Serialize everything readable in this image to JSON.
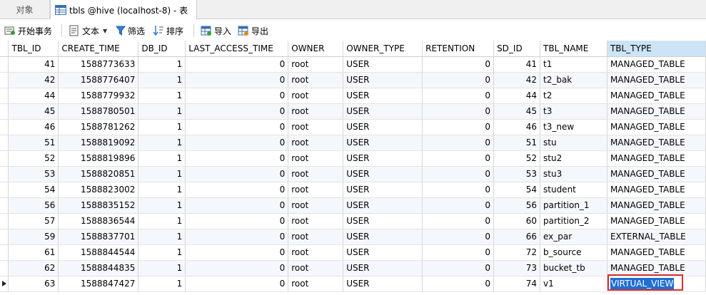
{
  "tabs": [
    {
      "label": "对象"
    },
    {
      "label": "tbls @hive (localhost-8) - 表"
    }
  ],
  "toolbar": {
    "begin_transaction": "开始事务",
    "text": "文本",
    "filter": "筛选",
    "sort": "排序",
    "import": "导入",
    "export": "导出"
  },
  "table": {
    "columns": [
      "TBL_ID",
      "CREATE_TIME",
      "DB_ID",
      "LAST_ACCESS_TIME",
      "OWNER",
      "OWNER_TYPE",
      "RETENTION",
      "SD_ID",
      "TBL_NAME",
      "TBL_TYPE"
    ],
    "selected_column": "TBL_TYPE",
    "rows": [
      [
        "41",
        "1588773633",
        "1",
        "0",
        "root",
        "USER",
        "0",
        "41",
        "t1",
        "MANAGED_TABLE"
      ],
      [
        "42",
        "1588776407",
        "1",
        "0",
        "root",
        "USER",
        "0",
        "42",
        "t2_bak",
        "MANAGED_TABLE"
      ],
      [
        "44",
        "1588779932",
        "1",
        "0",
        "root",
        "USER",
        "0",
        "44",
        "t2",
        "MANAGED_TABLE"
      ],
      [
        "45",
        "1588780501",
        "1",
        "0",
        "root",
        "USER",
        "0",
        "45",
        "t3",
        "MANAGED_TABLE"
      ],
      [
        "46",
        "1588781262",
        "1",
        "0",
        "root",
        "USER",
        "0",
        "46",
        "t3_new",
        "MANAGED_TABLE"
      ],
      [
        "51",
        "1588819092",
        "1",
        "0",
        "root",
        "USER",
        "0",
        "51",
        "stu",
        "MANAGED_TABLE"
      ],
      [
        "52",
        "1588819896",
        "1",
        "0",
        "root",
        "USER",
        "0",
        "52",
        "stu2",
        "MANAGED_TABLE"
      ],
      [
        "53",
        "1588820851",
        "1",
        "0",
        "root",
        "USER",
        "0",
        "53",
        "stu3",
        "MANAGED_TABLE"
      ],
      [
        "54",
        "1588823002",
        "1",
        "0",
        "root",
        "USER",
        "0",
        "54",
        "student",
        "MANAGED_TABLE"
      ],
      [
        "56",
        "1588835152",
        "1",
        "0",
        "root",
        "USER",
        "0",
        "56",
        "partition_1",
        "MANAGED_TABLE"
      ],
      [
        "57",
        "1588836544",
        "1",
        "0",
        "root",
        "USER",
        "0",
        "60",
        "partition_2",
        "MANAGED_TABLE"
      ],
      [
        "59",
        "1588837701",
        "1",
        "0",
        "root",
        "USER",
        "0",
        "66",
        "ex_par",
        "EXTERNAL_TABLE"
      ],
      [
        "61",
        "1588844544",
        "1",
        "0",
        "root",
        "USER",
        "0",
        "72",
        "b_source",
        "MANAGED_TABLE"
      ],
      [
        "62",
        "1588844835",
        "1",
        "0",
        "root",
        "USER",
        "0",
        "73",
        "bucket_tb",
        "MANAGED_TABLE"
      ],
      [
        "63",
        "1588847427",
        "1",
        "0",
        "root",
        "USER",
        "0",
        "74",
        "v1",
        "VIRTUAL_VIEW"
      ]
    ],
    "current_row": 14
  },
  "colors": {
    "selection": "#1f6fd1",
    "highlight_box": "#e02a2a",
    "header_selected": "#cde4f7"
  },
  "icons": [
    "table-icon",
    "begin-transaction-icon",
    "text-icon",
    "filter-icon",
    "sort-icon",
    "import-icon",
    "export-icon",
    "current-row-arrow-icon"
  ]
}
